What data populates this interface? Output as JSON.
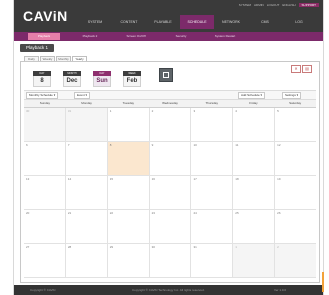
{
  "app": {
    "logo": "CAViN",
    "accent": "#7c2a6a",
    "highlight": "#e57fa9"
  },
  "header": {
    "util": [
      "SYSTEM",
      "ADMIN",
      "LOGOUT",
      "ENGLISH"
    ],
    "util_button": "SUPPORT",
    "nav": [
      "SYSTEM",
      "CONTENT",
      "PLAYABLE",
      "SCHEDULE",
      "NETWORK",
      "CMS",
      "LOG"
    ],
    "nav_active_index": 3
  },
  "subnav": {
    "items": [
      "Playback",
      "Playback 2",
      "Screen On/Off",
      "Security",
      "System Restart"
    ],
    "active_index": 0
  },
  "page_title": "Playback 1",
  "view_tabs": [
    "Daily",
    "Weekly",
    "Monthly",
    "Yearly"
  ],
  "view_tab_active_index": 3,
  "date_selector": [
    {
      "header": "DAY",
      "value": "8"
    },
    {
      "header": "MONTH",
      "value": "Dec"
    },
    {
      "header": "DAY",
      "value": "Sun"
    },
    {
      "header": "WEEK",
      "value": "Feb"
    }
  ],
  "date_selector_active_index": 2,
  "toolbar": {
    "filter": "Monthly Schedule",
    "group": "Event",
    "right1": "Add Schedule",
    "right2": "Settings"
  },
  "calendar": {
    "weekdays": [
      "Sunday",
      "Monday",
      "Tuesday",
      "Wednesday",
      "Thursday",
      "Friday",
      "Saturday"
    ],
    "weeks": [
      [
        "30",
        "31",
        "1",
        "2",
        "3",
        "4",
        "5"
      ],
      [
        "6",
        "7",
        "8",
        "9",
        "10",
        "11",
        "12"
      ],
      [
        "13",
        "14",
        "15",
        "16",
        "17",
        "18",
        "19"
      ],
      [
        "20",
        "21",
        "22",
        "23",
        "24",
        "25",
        "26"
      ],
      [
        "27",
        "28",
        "29",
        "30",
        "31",
        "1",
        "2"
      ]
    ],
    "today": "8"
  },
  "footer": {
    "left": "Copyright ® CAViN",
    "center": "Copyright ® CAViN Technology Inc. All rights reserved.",
    "right": "Ver 1.0.0"
  }
}
